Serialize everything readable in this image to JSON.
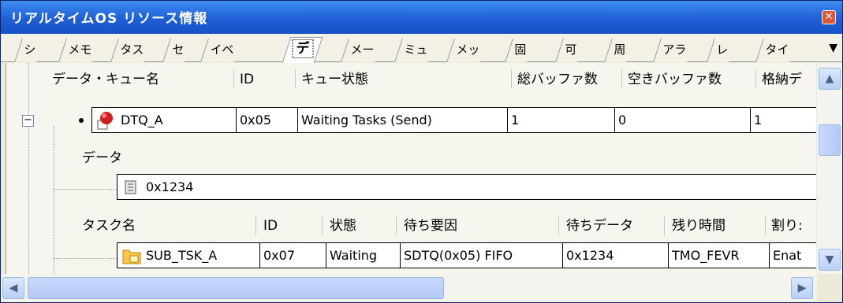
{
  "window": {
    "title": "リアルタイムOS リソース情報"
  },
  "tabs": [
    "シ",
    "メモ",
    "タス",
    "セ",
    "イベ",
    "デ",
    "メー",
    "ミュ",
    "メッ",
    "固",
    "可",
    "周",
    "アラ",
    "レ",
    "タイ"
  ],
  "active_tab": "デ",
  "dtq_table": {
    "headers": [
      "データ・キュー名",
      "ID",
      "キュー状態",
      "総バッファ数",
      "空きバッファ数",
      "格納デ"
    ],
    "row": {
      "name": "DTQ_A",
      "id": "0x05",
      "state": "Waiting Tasks (Send)",
      "total": "1",
      "free": "0",
      "stored": "1"
    }
  },
  "data_section": {
    "label": "データ",
    "value": "0x1234"
  },
  "task_table": {
    "headers": [
      "タスク名",
      "ID",
      "状態",
      "待ち要因",
      "待ちデータ",
      "残り時間",
      "割り:"
    ],
    "row": {
      "name": "SUB_TSK_A",
      "id": "0x07",
      "state": "Waiting",
      "reason": "SDTQ(0x05) FIFO",
      "data": "0x1234",
      "remaining": "TMO_FEVR",
      "interrupt": "Enat"
    }
  },
  "icons": {
    "close": "close-icon",
    "queue": "dtq-icon",
    "memory": "data-icon",
    "task": "task-folder-icon"
  }
}
